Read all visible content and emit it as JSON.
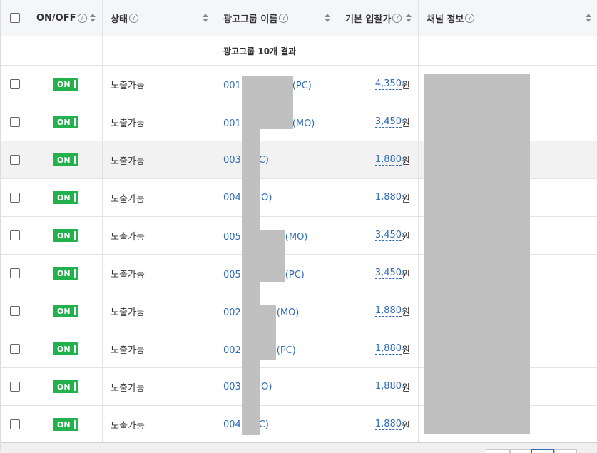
{
  "header": {
    "onoff": "ON/OFF",
    "status": "상태",
    "name": "광고그룹 이름",
    "bid": "기본 입찰가",
    "channel": "채널 정보"
  },
  "summary": {
    "count_text": "광고그룹 10개 결과"
  },
  "currency": "원",
  "rows": [
    {
      "toggle": "ON",
      "status": "노출가능",
      "name_prefix": "001",
      "name_suffix": "류(PC)",
      "bid": "4,350"
    },
    {
      "toggle": "ON",
      "status": "노출가능",
      "name_prefix": "001",
      "name_suffix": "류(MO)",
      "bid": "3,450"
    },
    {
      "toggle": "ON",
      "status": "노출가능",
      "name_prefix": "003",
      "name_suffix": "(PC)",
      "bid": "1,880"
    },
    {
      "toggle": "ON",
      "status": "노출가능",
      "name_prefix": "004",
      "name_suffix": "(MO)",
      "bid": "1,880"
    },
    {
      "toggle": "ON",
      "status": "노출가능",
      "name_prefix": "005",
      "name_suffix": "폼(MO)",
      "bid": "3,450"
    },
    {
      "toggle": "ON",
      "status": "노출가능",
      "name_prefix": "005",
      "name_suffix": "폼(PC)",
      "bid": "3,450"
    },
    {
      "toggle": "ON",
      "status": "노출가능",
      "name_prefix": "002",
      "name_suffix": "송(MO)",
      "bid": "1,880"
    },
    {
      "toggle": "ON",
      "status": "노출가능",
      "name_prefix": "002",
      "name_suffix": "송(PC)",
      "bid": "1,880"
    },
    {
      "toggle": "ON",
      "status": "노출가능",
      "name_prefix": "003",
      "name_suffix": "(MO)",
      "bid": "1,880"
    },
    {
      "toggle": "ON",
      "status": "노출가능",
      "name_prefix": "004",
      "name_suffix": "(PC)",
      "bid": "1,880"
    }
  ]
}
